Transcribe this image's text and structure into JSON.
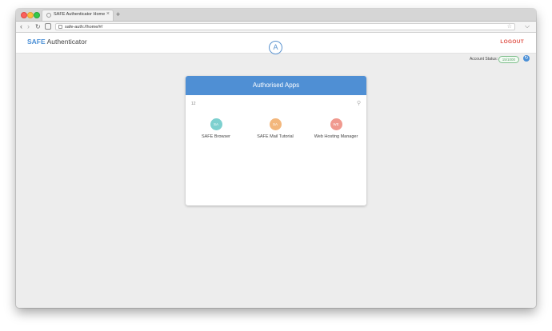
{
  "browser": {
    "tab_title": "SAFE Authenticator Home",
    "tab_close": "×",
    "new_tab": "+",
    "url": "safe-auth://home/#/",
    "back": "‹",
    "forward": "›",
    "reload": "↻",
    "bookmark": "☆",
    "menu": "⌵"
  },
  "header": {
    "brand_strong": "SAFE",
    "brand_rest": " Authenticator",
    "logo_letter": "A",
    "logout": "LOGOUT"
  },
  "account": {
    "label": "Account Status:",
    "badge": "15/1000",
    "refresh": "↻"
  },
  "card": {
    "title": "Authorised Apps",
    "count": "12",
    "search_icon": "⚲",
    "apps": [
      {
        "initials": "SA",
        "name": "SAFE Browser",
        "color": "#7dd0cf"
      },
      {
        "initials": "SA",
        "name": "SAFE Mail Tutorial",
        "color": "#f3b77c"
      },
      {
        "initials": "WE",
        "name": "Web Hosting Manager",
        "color": "#f0998f"
      }
    ]
  },
  "colors": {
    "accent": "#4f8fd4",
    "logout": "#e0544a",
    "status_ok": "#5aa06a"
  }
}
